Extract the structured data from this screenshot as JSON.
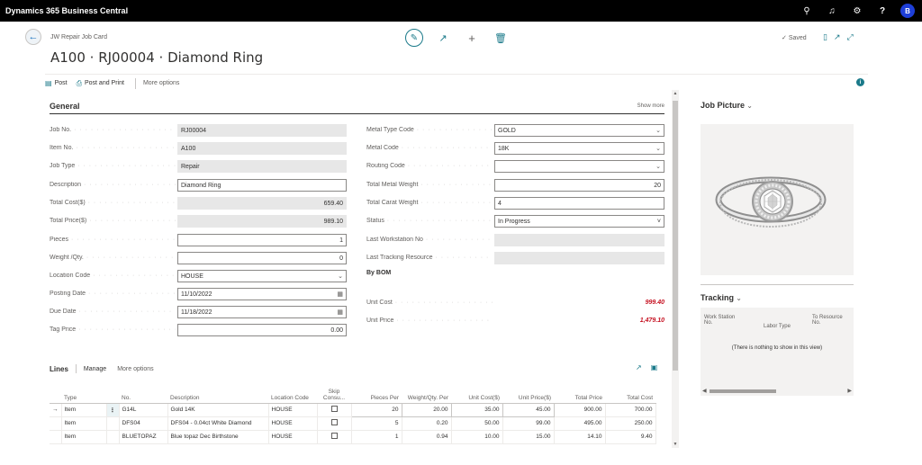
{
  "app": {
    "title": "Dynamics 365 Business Central",
    "avatar": "B"
  },
  "page": {
    "breadcrumb": "JW Repair Job Card",
    "title": "A100 · RJ00004 · Diamond Ring",
    "status": "Saved"
  },
  "actions": {
    "post": "Post",
    "post_and_print": "Post and Print",
    "more_options": "More options"
  },
  "general": {
    "title": "General",
    "show_more": "Show more",
    "left": [
      {
        "label": "Job No.",
        "value": "RJ00004"
      },
      {
        "label": "Item No.",
        "value": "A100"
      },
      {
        "label": "Job Type",
        "value": "Repair"
      },
      {
        "label": "Description",
        "value": "Diamond Ring"
      },
      {
        "label": "Total Cost($)",
        "value": "659.40"
      },
      {
        "label": "Total Price($)",
        "value": "989.10"
      },
      {
        "label": "Pieces",
        "value": "1"
      },
      {
        "label": "Weight /Qty.",
        "value": "0"
      },
      {
        "label": "Location Code",
        "value": "HOUSE"
      },
      {
        "label": "Posting Date",
        "value": "11/10/2022"
      },
      {
        "label": "Due Date",
        "value": "11/18/2022"
      },
      {
        "label": "Tag Price",
        "value": "0.00"
      }
    ],
    "right": [
      {
        "label": "Metal Type Code",
        "value": "GOLD"
      },
      {
        "label": "Metal Code",
        "value": "18K"
      },
      {
        "label": "Routing Code",
        "value": ""
      },
      {
        "label": "Total Metal Weight",
        "value": "20"
      },
      {
        "label": "Total Carat Weight",
        "value": "4"
      },
      {
        "label": "Status",
        "value": "In Progress"
      },
      {
        "label": "Last Workstation No",
        "value": ""
      },
      {
        "label": "Last Tracking Resource",
        "value": ""
      }
    ],
    "by_bom": "By BOM",
    "unit_cost": {
      "label": "Unit Cost",
      "value": "999.40"
    },
    "unit_price": {
      "label": "Unit Price",
      "value": "1,479.10"
    }
  },
  "lines": {
    "title": "Lines",
    "manage": "Manage",
    "more_options": "More options",
    "columns": [
      "Type",
      "No.",
      "Description",
      "Location Code",
      "Skip Consu...",
      "Pieces Per",
      "Weight/Qty. Per",
      "Unit Cost($)",
      "Unit Price($)",
      "Total Price",
      "Total Cost"
    ],
    "rows": [
      {
        "type": "Item",
        "no": "G14L",
        "description": "Gold 14K",
        "location": "HOUSE",
        "pieces": "20",
        "weight": "20.00",
        "unit_cost": "35.00",
        "unit_price": "45.00",
        "total_price": "900.00",
        "total_cost": "700.00"
      },
      {
        "type": "Item",
        "no": "DFS04",
        "description": "DFS04 - 0.04ct  White Diamond",
        "location": "HOUSE",
        "pieces": "5",
        "weight": "0.20",
        "unit_cost": "50.00",
        "unit_price": "99.00",
        "total_price": "495.00",
        "total_cost": "250.00"
      },
      {
        "type": "Item",
        "no": "BLUETOPAZ",
        "description": "Blue topaz Dec Birthstone",
        "location": "HOUSE",
        "pieces": "1",
        "weight": "0.94",
        "unit_cost": "10.00",
        "unit_price": "15.00",
        "total_price": "14.10",
        "total_cost": "9.40"
      }
    ]
  },
  "factbox": {
    "job_picture": "Job Picture",
    "tracking": "Tracking",
    "tracking_cols": [
      "Work Station No.",
      "Labor Type",
      "To Resource No."
    ],
    "tracking_empty": "(There is nothing to show in this view)"
  }
}
